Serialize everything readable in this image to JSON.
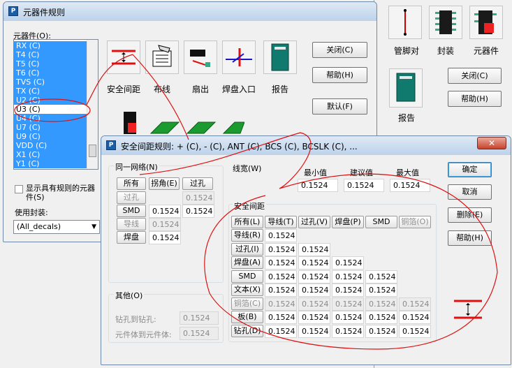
{
  "bg_window": {
    "toolbar_labels": [
      "管脚对",
      "封装",
      "元器件"
    ],
    "buttons": [
      "关闭(C)",
      "帮助(H)"
    ],
    "report_label": "报告"
  },
  "rules_dialog": {
    "title": "元器件规则",
    "list_label": "元器件(O):",
    "items": [
      {
        "label": "RX (C)",
        "selected": true
      },
      {
        "label": "T4 (C)",
        "selected": true
      },
      {
        "label": "T5 (C)",
        "selected": true
      },
      {
        "label": "T6 (C)",
        "selected": true
      },
      {
        "label": "TVS (C)",
        "selected": true
      },
      {
        "label": "TX (C)",
        "selected": true
      },
      {
        "label": "U2 (C)",
        "selected": true
      },
      {
        "label": "U3 (C)",
        "selected": false
      },
      {
        "label": "U4 (C)",
        "selected": true
      },
      {
        "label": "U7 (C)",
        "selected": true
      },
      {
        "label": "U9 (C)",
        "selected": true
      },
      {
        "label": "VDD (C)",
        "selected": true
      },
      {
        "label": "X1 (C)",
        "selected": true
      },
      {
        "label": "Y1 (C)",
        "selected": true
      }
    ],
    "checkbox_label": "显示具有规则的元器件(S)",
    "decal_label": "使用封装:",
    "decal_value": "(All_decals)",
    "tools": [
      "安全间距",
      "布线",
      "扇出",
      "焊盘入口",
      "报告"
    ],
    "buttons": [
      "关闭(C)",
      "帮助(H)",
      "默认(F)"
    ]
  },
  "clearance_dialog": {
    "title": "安全间距规则: + (C), - (C), ANT (C), BCS (C), BCSLK (C), ...",
    "close": "✕",
    "same_net": {
      "label": "同一网络(N)",
      "headers": [
        "所有",
        "拐角(E)",
        "过孔"
      ],
      "rows": [
        {
          "label": "过孔",
          "enabled": false,
          "values": [
            "",
            "0.1524"
          ]
        },
        {
          "label": "SMD",
          "enabled": true,
          "values": [
            "0.1524",
            "0.1524"
          ]
        },
        {
          "label": "导线",
          "enabled": false,
          "values": [
            "0.1524"
          ]
        },
        {
          "label": "焊盘",
          "enabled": true,
          "values": [
            "0.1524"
          ]
        }
      ]
    },
    "trace_width": {
      "label": "线宽(W)",
      "headers": [
        "最小值",
        "建议值",
        "最大值"
      ],
      "values": [
        "0.1524",
        "0.1524",
        "0.1524"
      ]
    },
    "clearance": {
      "label": "安全间距",
      "headers": [
        {
          "text": "所有(L)",
          "enabled": true
        },
        {
          "text": "导线(T)",
          "enabled": true
        },
        {
          "text": "过孔(V)",
          "enabled": true
        },
        {
          "text": "焊盘(P)",
          "enabled": true
        },
        {
          "text": "SMD",
          "enabled": true
        },
        {
          "text": "铜箔(O)",
          "enabled": false
        }
      ],
      "rows": [
        {
          "label": "导线(R)",
          "enabled": true,
          "values": [
            "0.1524"
          ]
        },
        {
          "label": "过孔(I)",
          "enabled": true,
          "values": [
            "0.1524",
            "0.1524"
          ]
        },
        {
          "label": "焊盘(A)",
          "enabled": true,
          "values": [
            "0.1524",
            "0.1524",
            "0.1524"
          ]
        },
        {
          "label": "SMD",
          "enabled": true,
          "values": [
            "0.1524",
            "0.1524",
            "0.1524",
            "0.1524"
          ]
        },
        {
          "label": "文本(X)",
          "enabled": true,
          "values": [
            "0.1524",
            "0.1524",
            "0.1524",
            "0.1524"
          ]
        },
        {
          "label": "铜箔(C)",
          "enabled": false,
          "values": [
            "0.1524",
            "0.1524",
            "0.1524",
            "0.1524",
            "0.1524"
          ]
        },
        {
          "label": "板(B)",
          "enabled": true,
          "values": [
            "0.1524",
            "0.1524",
            "0.1524",
            "0.1524",
            "0.1524"
          ]
        },
        {
          "label": "钻孔(D)",
          "enabled": true,
          "values": [
            "0.1524",
            "0.1524",
            "0.1524",
            "0.1524",
            "0.1524"
          ]
        }
      ]
    },
    "other": {
      "label": "其他(O)",
      "rows": [
        {
          "label": "钻孔到钻孔:",
          "value": "0.1524"
        },
        {
          "label": "元件体到元件体:",
          "value": "0.1524"
        }
      ]
    },
    "buttons": [
      "确定",
      "取消",
      "删除(E)",
      "帮助(H)"
    ]
  },
  "colors": {
    "selection": "#3399ff",
    "annotation": "#dd1111"
  }
}
